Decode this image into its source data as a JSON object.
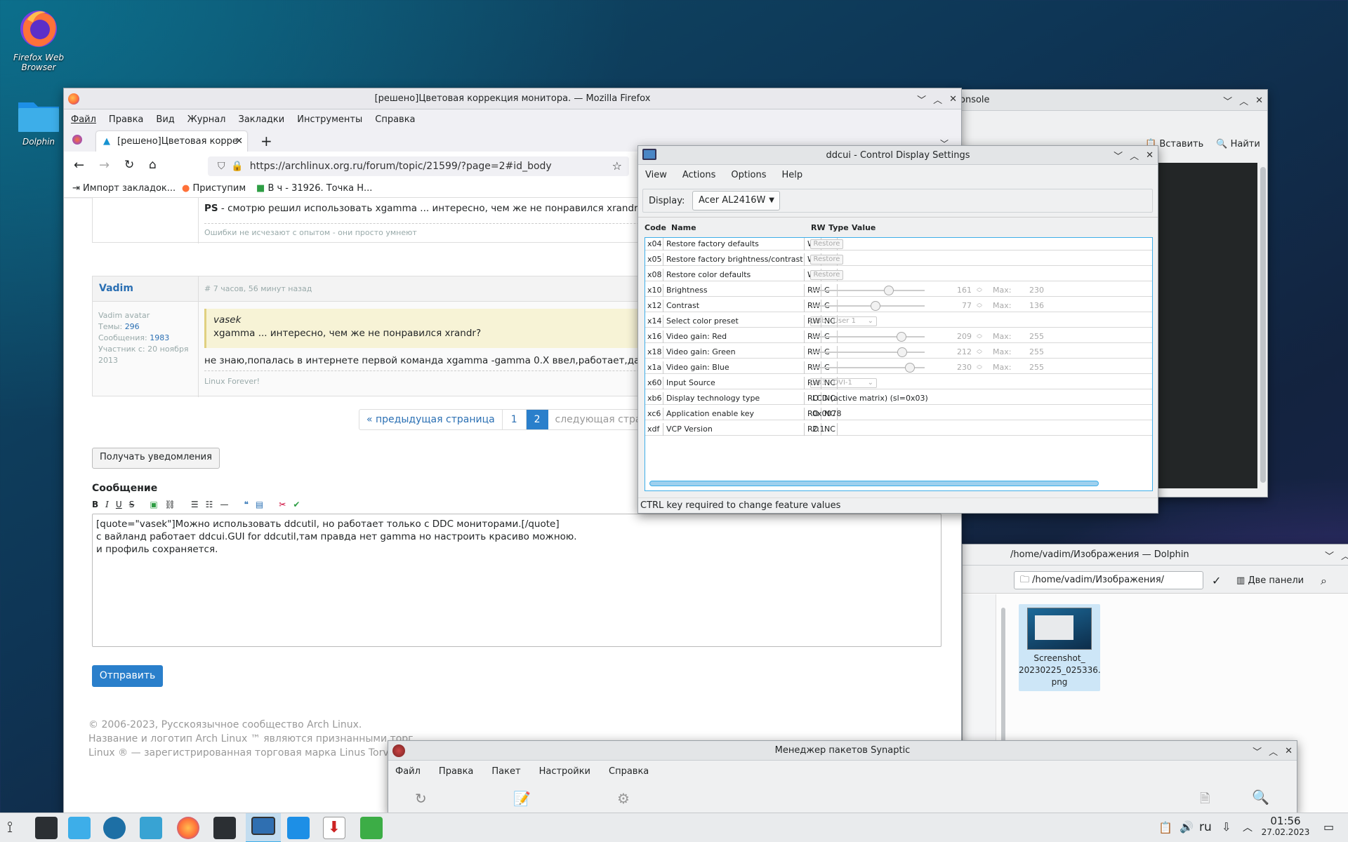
{
  "desktop": {
    "icons": [
      {
        "label": "Firefox Web Browser"
      },
      {
        "label": "Dolphin"
      }
    ]
  },
  "firefox": {
    "title": "[решено]Цветовая коррекция монитора. — Mozilla Firefox",
    "menu": [
      "Файл",
      "Правка",
      "Вид",
      "Журнал",
      "Закладки",
      "Инструменты",
      "Справка"
    ],
    "tab_label": "[решено]Цветовая корре",
    "url": "https://archlinux.org.ru/forum/topic/21599/?page=2#id_body",
    "bookmarks": [
      "Импорт закладок...",
      "Приступим",
      "В ч - 31926. Точка Н..."
    ],
    "prev_post": {
      "ps_label": "PS",
      "ps_text": " - смотрю решил использовать xgamma ... интересно, чем же не понравился xrandr?",
      "signature": "Ошибки не исчезают с опытом - они просто умнеют"
    },
    "post": {
      "author": "Vadim",
      "time": "# 7 часов, 56 минут назад",
      "avatar_alt": "Vadim avatar",
      "topics_label": "Темы:",
      "topics": "296",
      "messages_label": "Сообщения:",
      "messages": "1983",
      "member_since": "Участник с: 20 ноября 2013",
      "quote_author": "vasek",
      "quote_text": "xgamma ... интересно, чем же не понравился xrandr?",
      "body": "не знаю,попалась в интернете первой команда xgamma -gamma 0.X ввел,работает,дальше",
      "signature": "Linux Forever!"
    },
    "pagination": {
      "prev": "« предыдущая страница",
      "p1": "1",
      "p2": "2",
      "next": "следующая страни"
    },
    "notify_button": "Получать уведомления",
    "message_label": "Сообщение",
    "editor_lines": [
      "[quote=\"vasek\"]Можно использовать ddcutil, но работает только с DDC мониторами.[/quote]",
      "с вайланд работает ddcui.GUI for ddcutil,там правда нет gamma но настроить красиво можною.",
      "и профиль сохраняется."
    ],
    "submit_button": "Отправить",
    "footer": [
      "© 2006-2023, Русскоязычное сообщество Arch Linux.",
      "Название и логотип Arch Linux ™ являются признанными торг",
      "Linux ® — зарегистрированная торговая марка Linus Torvalds"
    ]
  },
  "konsole": {
    "title": "onsole",
    "paste_label": "Вставить",
    "find_label": "Найти"
  },
  "ddcui": {
    "title": "ddcui - Control Display Settings",
    "menu": [
      "View",
      "Actions",
      "Options",
      "Help"
    ],
    "display_label": "Display:",
    "display_value": "Acer AL2416W",
    "headers": {
      "code": "Code",
      "name": "Name",
      "rw": "RW",
      "type": "Type",
      "value": "Value"
    },
    "rows": [
      {
        "code": "x04",
        "name": "Restore factory defaults",
        "rw": "WO",
        "type": "NC",
        "kind": "button",
        "value": "Restore"
      },
      {
        "code": "x05",
        "name": "Restore factory brightness/contrast de",
        "rw": "WO",
        "type": "NC",
        "kind": "button",
        "value": "Restore"
      },
      {
        "code": "x08",
        "name": "Restore color defaults",
        "rw": "WO",
        "type": "NC",
        "kind": "button",
        "value": "Restore"
      },
      {
        "code": "x10",
        "name": "Brightness",
        "rw": "RW",
        "type": "C",
        "kind": "slider",
        "value": "161",
        "max_label": "Max:",
        "max": "230"
      },
      {
        "code": "x12",
        "name": "Contrast",
        "rw": "RW",
        "type": "C",
        "kind": "slider",
        "value": "77",
        "max_label": "Max:",
        "max": "136"
      },
      {
        "code": "x14",
        "name": "Select color preset",
        "rw": "RW",
        "type": "NC",
        "kind": "combo",
        "value": "x0b - User 1"
      },
      {
        "code": "x16",
        "name": "Video gain: Red",
        "rw": "RW",
        "type": "C",
        "kind": "slider",
        "value": "209",
        "max_label": "Max:",
        "max": "255"
      },
      {
        "code": "x18",
        "name": "Video gain: Green",
        "rw": "RW",
        "type": "C",
        "kind": "slider",
        "value": "212",
        "max_label": "Max:",
        "max": "255"
      },
      {
        "code": "x1a",
        "name": "Video gain: Blue",
        "rw": "RW",
        "type": "C",
        "kind": "slider",
        "value": "230",
        "max_label": "Max:",
        "max": "255"
      },
      {
        "code": "x60",
        "name": "Input Source",
        "rw": "RW",
        "type": "NC",
        "kind": "combo",
        "value": "x03 - DVI-1"
      },
      {
        "code": "xb6",
        "name": "Display technology type",
        "rw": "RO",
        "type": "NC",
        "kind": "text",
        "value": "LCD (active matrix) (sl=0x03)"
      },
      {
        "code": "xc6",
        "name": "Application enable key",
        "rw": "RO",
        "type": "NC",
        "kind": "text",
        "value": "0x0078"
      },
      {
        "code": "xdf",
        "name": "VCP Version",
        "rw": "RO",
        "type": "NC",
        "kind": "text",
        "value": "2.1"
      }
    ],
    "status": "CTRL key required to change feature values"
  },
  "dolphin": {
    "title": "/home/vadim/Изображения — Dolphin",
    "path": "/home/vadim/Изображения/",
    "split_label": "Две панели",
    "file_name_lines": [
      "Screenshot_",
      "20230225_025336.",
      "png"
    ]
  },
  "synaptic": {
    "title": "Менеджер пакетов Synaptic",
    "menu": [
      "Файл",
      "Правка",
      "Пакет",
      "Настройки",
      "Справка"
    ]
  },
  "taskbar": {
    "lang": "ru",
    "time": "01:56",
    "date": "27.02.2023"
  }
}
